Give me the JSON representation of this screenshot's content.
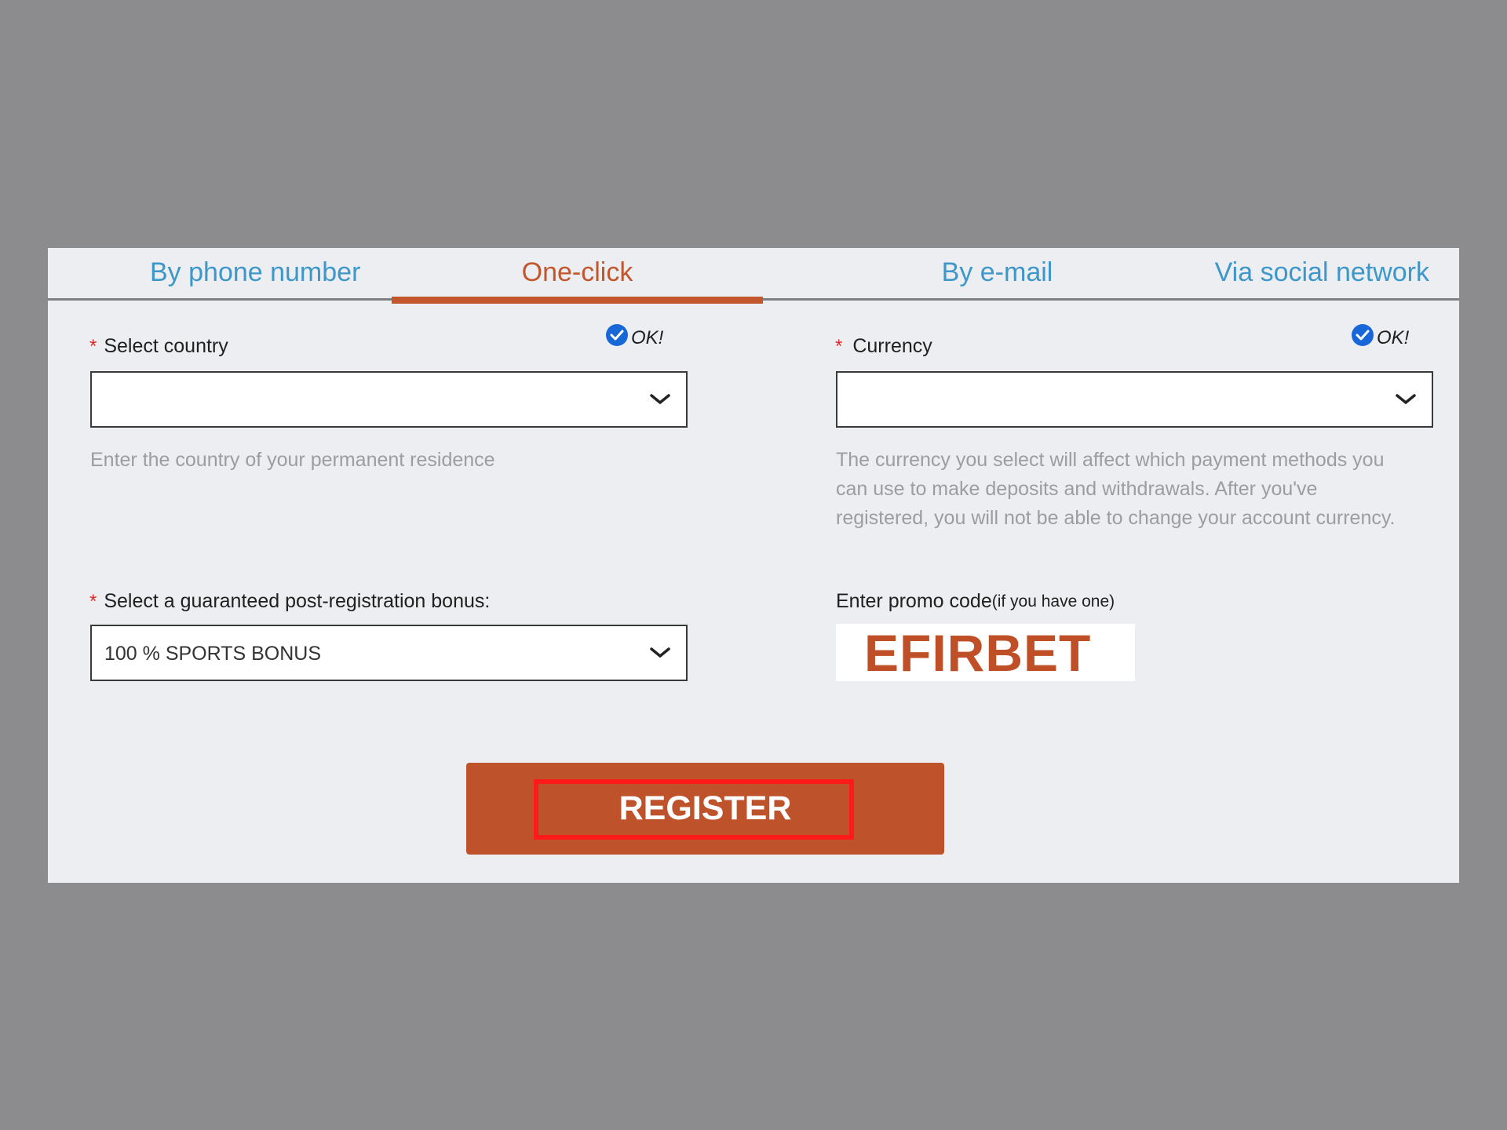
{
  "tabs": [
    {
      "label": "By phone number",
      "active": false
    },
    {
      "label": "One-click",
      "active": true
    },
    {
      "label": "By e-mail",
      "active": false
    },
    {
      "label": "Via social network",
      "active": false
    }
  ],
  "country": {
    "required_mark": "*",
    "label": "Select country",
    "status": "OK!",
    "value": "",
    "hint": "Enter the country of your permanent residence"
  },
  "currency": {
    "required_mark": "*",
    "label": "Currency",
    "status": "OK!",
    "value": "",
    "hint_lines": [
      "The currency you select will affect which payment methods you",
      "can use to make deposits and withdrawals. After you've",
      "registered, you will not be able to change your account currency."
    ]
  },
  "bonus": {
    "required_mark": "*",
    "label": "Select a guaranteed post-registration bonus:",
    "value": "100 % SPORTS BONUS"
  },
  "promo": {
    "label": "Enter promo code",
    "label_suffix": "(if you have one)",
    "value": "EFIRBET"
  },
  "register": {
    "label": "REGISTER"
  },
  "colors": {
    "accent": "#c2562d",
    "tab_link": "#3d97c9",
    "ok_check": "#1767d8",
    "highlight_box": "#ff1a1a"
  },
  "icons": {
    "ok": "check-circle-icon",
    "dropdown": "chevron-down-icon"
  }
}
